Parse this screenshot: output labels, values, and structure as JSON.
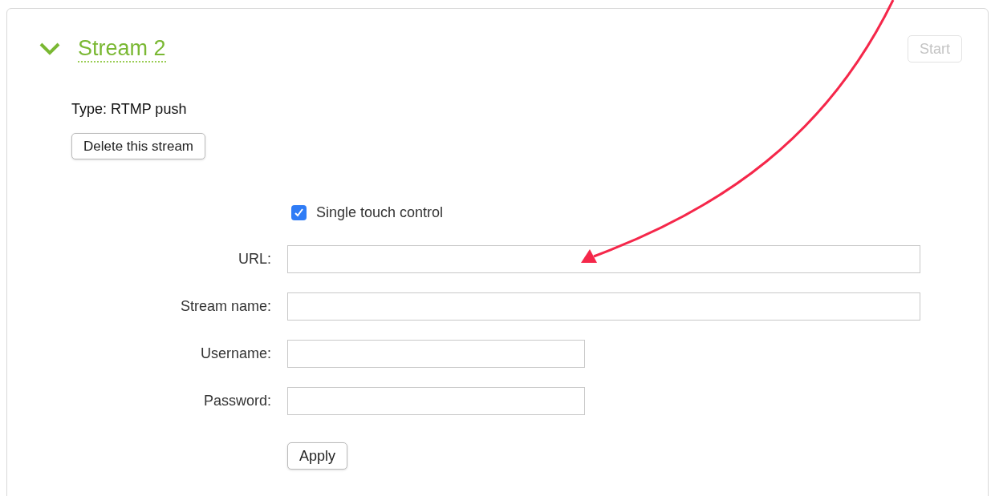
{
  "stream": {
    "title": "Stream 2",
    "expanded": true
  },
  "start_button": {
    "label": "Start",
    "disabled": true
  },
  "type_text": "Type: RTMP push",
  "delete_button": "Delete this stream",
  "single_touch": {
    "label": "Single touch control",
    "checked": true
  },
  "fields": [
    {
      "label": "URL:",
      "kind": "wide"
    },
    {
      "label": "Stream name:",
      "kind": "wide"
    },
    {
      "label": "Username:",
      "kind": "narrow"
    },
    {
      "label": "Password:",
      "kind": "narrow"
    }
  ],
  "apply_button": "Apply"
}
